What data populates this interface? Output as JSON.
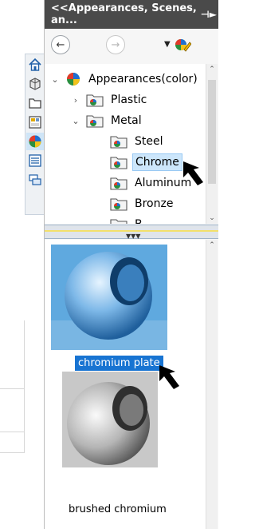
{
  "panel": {
    "title": "<<Appearances, Scenes, an...",
    "pin_icon": "pin-icon"
  },
  "toolbar": {
    "back_icon": "arrow-left-icon",
    "forward_icon": "arrow-right-icon",
    "dropdown_icon": "dropdown-icon",
    "edit_icon": "appearance-pen-icon"
  },
  "sidetabs": [
    {
      "icon": "home-icon"
    },
    {
      "icon": "3d-part-icon"
    },
    {
      "icon": "folder-icon"
    },
    {
      "icon": "view-palette-icon"
    },
    {
      "icon": "appearance-ball-icon",
      "active": true
    },
    {
      "icon": "properties-icon"
    },
    {
      "icon": "custom-properties-icon"
    }
  ],
  "tree": {
    "items": [
      {
        "label": "Appearances(color)",
        "level": 0
      },
      {
        "label": "Plastic",
        "level": 1
      },
      {
        "label": "Metal",
        "level": 1
      },
      {
        "label": "Steel",
        "level": 2
      },
      {
        "label": "Chrome",
        "level": 2,
        "selected": true
      },
      {
        "label": "Aluminum",
        "level": 2
      },
      {
        "label": "Bronze",
        "level": 2
      },
      {
        "label": "B...",
        "level": 2
      }
    ]
  },
  "gallery": {
    "items": [
      {
        "label": "chromium plate",
        "selected": true
      },
      {
        "label": "brushed chromium",
        "selected": false
      }
    ]
  },
  "colors": {
    "titlebar": "#4a4a4a",
    "selection": "#1874d2",
    "tree_selection": "#cce6fb",
    "tab_active": "#cfe5f7"
  }
}
